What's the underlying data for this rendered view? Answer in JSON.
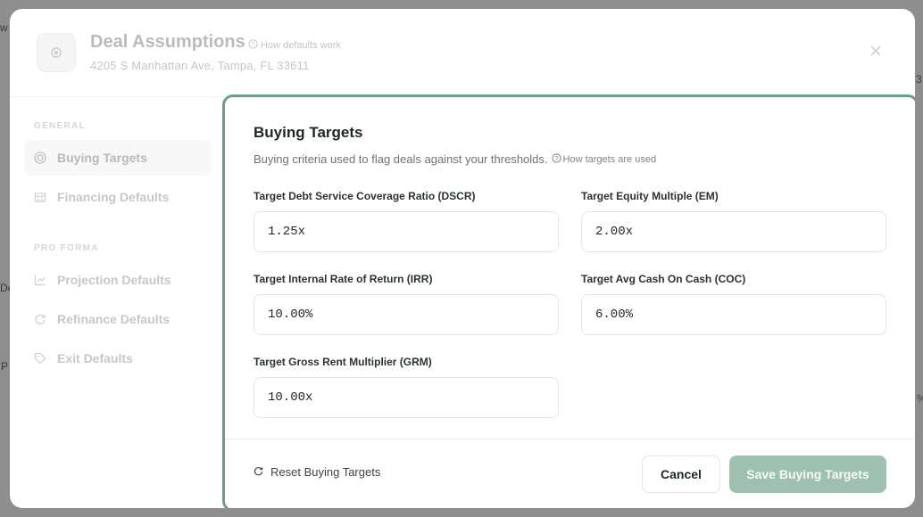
{
  "background": {
    "fragments": [
      "w",
      "3",
      "De",
      "P",
      "%"
    ]
  },
  "modal": {
    "title": "Deal Assumptions",
    "help_link": "How defaults work",
    "address": "4205 S Manhattan Ave, Tampa, FL 33611",
    "close_icon": "close-icon"
  },
  "sidebar": {
    "section_general": "GENERAL",
    "section_pro_forma": "PRO FORMA",
    "items": [
      {
        "label": "Buying Targets",
        "icon": "target-icon",
        "active": true
      },
      {
        "label": "Financing Defaults",
        "icon": "bank-icon",
        "active": false
      },
      {
        "label": "Projection Defaults",
        "icon": "chart-icon",
        "active": false
      },
      {
        "label": "Refinance Defaults",
        "icon": "refresh-icon",
        "active": false
      },
      {
        "label": "Exit Defaults",
        "icon": "tag-icon",
        "active": false
      }
    ]
  },
  "panel": {
    "title": "Buying Targets",
    "description": "Buying criteria used to flag deals against your thresholds.",
    "help_link": "How targets are used",
    "fields": {
      "dscr": {
        "label": "Target Debt Service Coverage Ratio (DSCR)",
        "value": "1.25x"
      },
      "em": {
        "label": "Target Equity Multiple (EM)",
        "value": "2.00x"
      },
      "irr": {
        "label": "Target Internal Rate of Return (IRR)",
        "value": "10.00%"
      },
      "coc": {
        "label": "Target Avg Cash On Cash (COC)",
        "value": "6.00%"
      },
      "grm": {
        "label": "Target Gross Rent Multiplier (GRM)",
        "value": "10.00x"
      }
    },
    "footer": {
      "reset_label": "Reset Buying Targets",
      "cancel_label": "Cancel",
      "save_label": "Save Buying Targets"
    }
  },
  "colors": {
    "accent": "#6f9c8a",
    "save_button": "#9dc0b1"
  }
}
